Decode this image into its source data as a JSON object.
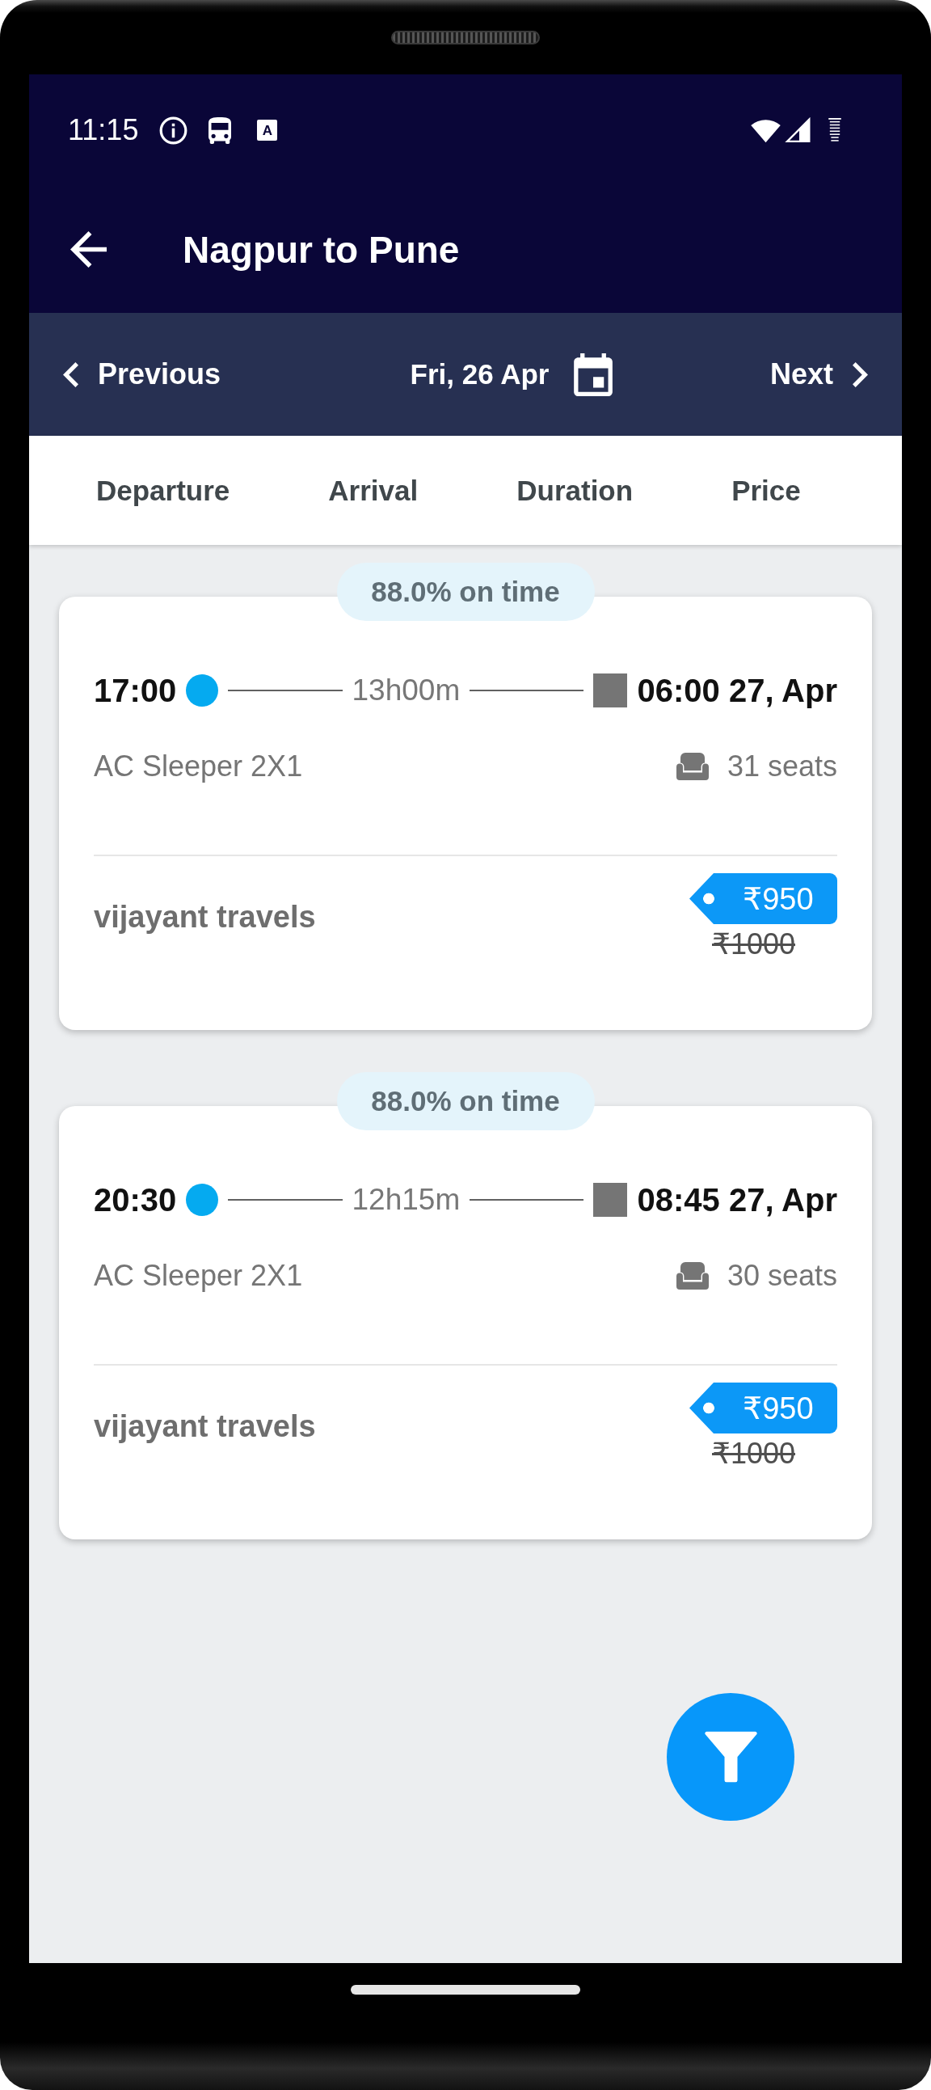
{
  "status_bar": {
    "time": "11:15",
    "notification_badge": "A"
  },
  "toolbar": {
    "title": "Nagpur to Pune"
  },
  "date_bar": {
    "previous": "Previous",
    "date": "Fri, 26 Apr",
    "next": "Next"
  },
  "sort_options": [
    "Departure",
    "Arrival",
    "Duration",
    "Price"
  ],
  "trips": [
    {
      "on_time": "88.0% on time",
      "departure": "17:00",
      "duration": "13h00m",
      "arrival": "06:00 27, Apr",
      "bus_type": "AC Sleeper 2X1",
      "seats": "31 seats",
      "operator": "vijayant travels",
      "price": "₹950",
      "original_price": "₹1000"
    },
    {
      "on_time": "88.0% on time",
      "departure": "20:30",
      "duration": "12h15m",
      "arrival": "08:45 27, Apr",
      "bus_type": "AC Sleeper 2X1",
      "seats": "30 seats",
      "operator": "vijayant travels",
      "price": "₹950",
      "original_price": "₹1000"
    }
  ]
}
